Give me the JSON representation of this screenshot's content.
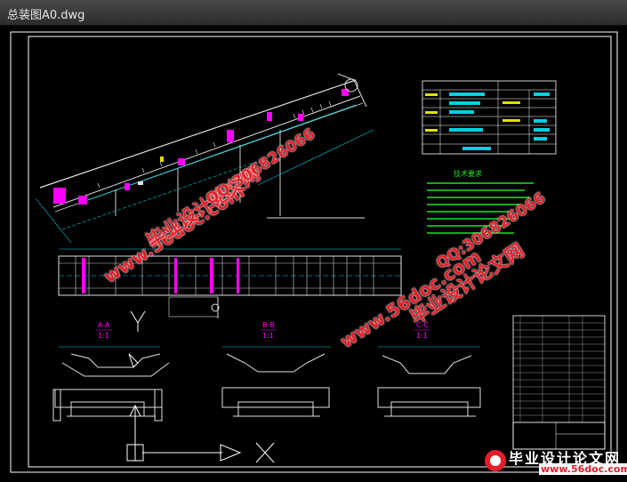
{
  "window": {
    "title": "总装图A0.dwg"
  },
  "colors": {
    "background": "#000000",
    "frame": "#ffffff",
    "cyan": "#00d0e0",
    "magenta": "#ff00ff",
    "green": "#20e020",
    "yellow": "#e0e000",
    "watermark": "#e3202a"
  },
  "drawing": {
    "section_labels": [
      {
        "name": "A-A",
        "scale": "1:1"
      },
      {
        "name": "B-B",
        "scale": "1:1"
      },
      {
        "name": "C-C",
        "scale": "1:1"
      }
    ],
    "tech_notes_title": "技术要求"
  },
  "watermarks": {
    "site": "www.56doc.com",
    "cn": "毕业设计论文网",
    "qq": "QQ:306826066"
  },
  "logo": {
    "cn": "毕业设计论文网",
    "url": "www.56doc.com"
  }
}
